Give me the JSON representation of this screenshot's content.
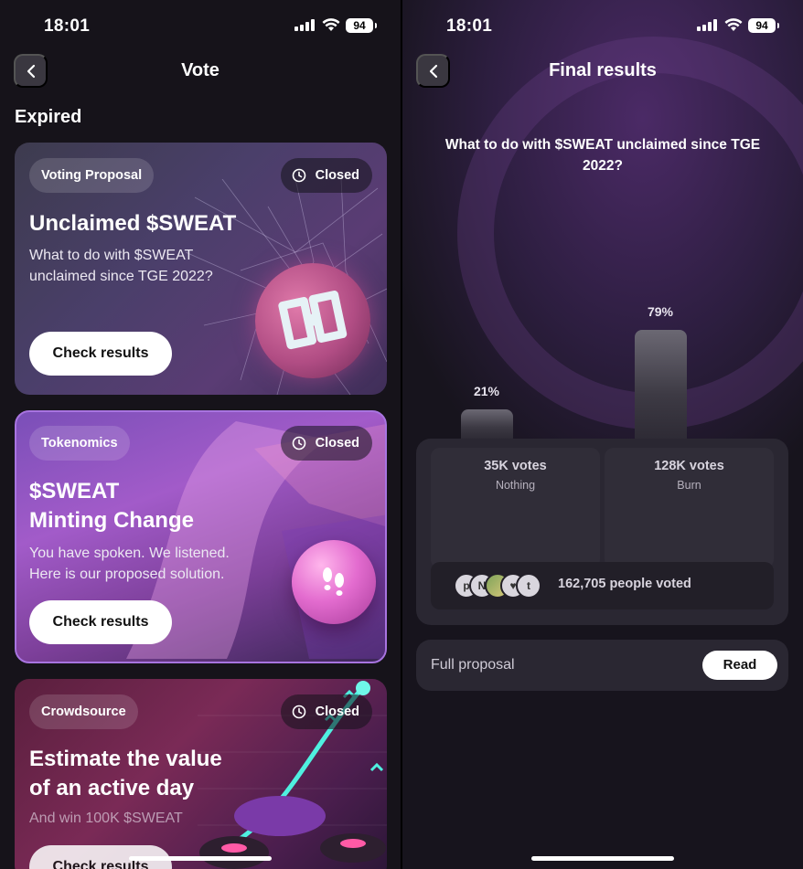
{
  "left_screen": {
    "status": {
      "time": "18:01",
      "battery": "94"
    },
    "nav": {
      "title": "Vote"
    },
    "section_title": "Expired",
    "cards": [
      {
        "category": "Voting Proposal",
        "status": "Closed",
        "title": "Unclaimed $SWEAT",
        "subtitle": "What to do with $SWEAT unclaimed since TGE 2022?",
        "button": "Check results"
      },
      {
        "category": "Tokenomics",
        "status": "Closed",
        "title_line1": "$SWEAT",
        "title_line2": "Minting Change",
        "subtitle_line1": "You have spoken. We listened.",
        "subtitle_line2": "Here is our proposed solution.",
        "button": "Check results"
      },
      {
        "category": "Crowdsource",
        "status": "Closed",
        "title_line1": "Estimate the value",
        "title_line2": "of an active day",
        "subtitle": "And win 100K $SWEAT",
        "button": "Check results"
      }
    ]
  },
  "right_screen": {
    "status": {
      "time": "18:01",
      "battery": "94"
    },
    "nav": {
      "title": "Final results"
    },
    "question": "What to do with $SWEAT unclaimed since TGE 2022?",
    "options": [
      {
        "percent_label": "21%",
        "share": 0.21,
        "votes": "35K votes",
        "name": "Nothing"
      },
      {
        "percent_label": "79%",
        "share": 0.79,
        "votes": "128K votes",
        "name": "Burn"
      }
    ],
    "voters": {
      "avatars": [
        "p",
        "N",
        "",
        "♥",
        "t"
      ],
      "text": "162,705 people voted"
    },
    "proposal": {
      "label": "Full proposal",
      "button": "Read"
    }
  },
  "colors": {
    "background": "#16131a",
    "card_accent": "#a874e0",
    "button_bg": "#ffffff"
  }
}
